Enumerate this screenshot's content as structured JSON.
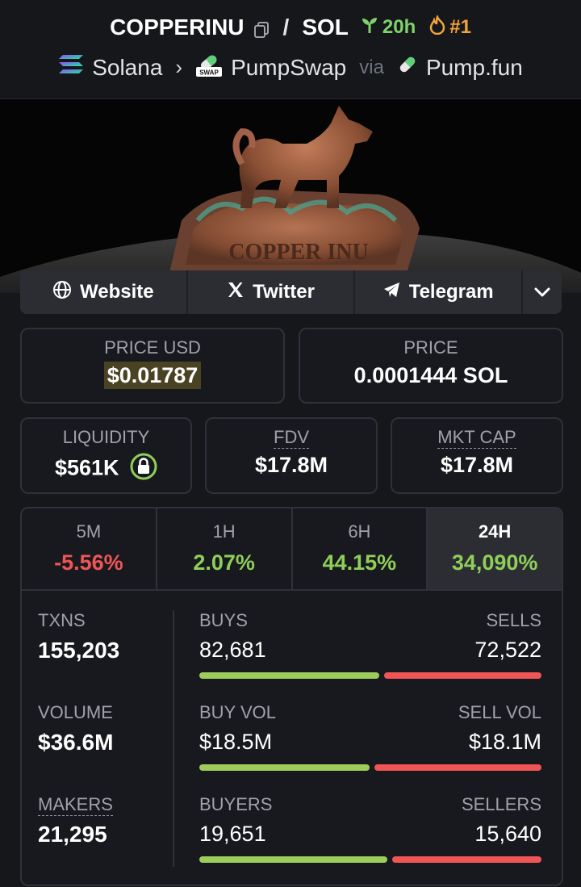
{
  "header": {
    "token_symbol": "COPPERINU",
    "separator": "/",
    "quote_symbol": "SOL",
    "age": "20h",
    "rank": "#1",
    "chain": "Solana",
    "dex": "PumpSwap",
    "via": "via",
    "launchpad": "Pump.fun",
    "dex_badge": "SWAP"
  },
  "banner": {
    "statue_text": "COPPER INU"
  },
  "socials": {
    "website": "Website",
    "twitter": "Twitter",
    "telegram": "Telegram"
  },
  "price": {
    "usd_label": "PRICE USD",
    "usd_value": "$0.01787",
    "native_label": "PRICE",
    "native_value": "0.0001444 SOL"
  },
  "metrics": {
    "liquidity_label": "LIQUIDITY",
    "liquidity_value": "$561K",
    "fdv_label": "FDV",
    "fdv_value": "$17.8M",
    "mcap_label": "MKT CAP",
    "mcap_value": "$17.8M"
  },
  "timeframes": [
    {
      "name": "5M",
      "change": "-5.56%"
    },
    {
      "name": "1H",
      "change": "2.07%"
    },
    {
      "name": "6H",
      "change": "44.15%"
    },
    {
      "name": "24H",
      "change": "34,090%"
    }
  ],
  "stats": {
    "txns_label": "TXNS",
    "txns_value": "155,203",
    "volume_label": "VOLUME",
    "volume_value": "$36.6M",
    "makers_label": "MAKERS",
    "makers_value": "21,295",
    "buys_label": "BUYS",
    "buys_value": "82,681",
    "sells_label": "SELLS",
    "sells_value": "72,522",
    "buy_vol_label": "BUY VOL",
    "buy_vol_value": "$18.5M",
    "sell_vol_label": "SELL VOL",
    "sell_vol_value": "$18.1M",
    "buyers_label": "BUYERS",
    "buyers_value": "19,651",
    "sellers_label": "SELLERS",
    "sellers_value": "15,640"
  },
  "bar_ratios": {
    "txns_buy_fraction": 0.533,
    "volume_buy_fraction": 0.505,
    "makers_buy_fraction": 0.557
  },
  "colors": {
    "positive": "#8fcf59",
    "negative": "#ef5555",
    "age_green": "#7fd36b",
    "rank_orange": "#f2a33a"
  }
}
